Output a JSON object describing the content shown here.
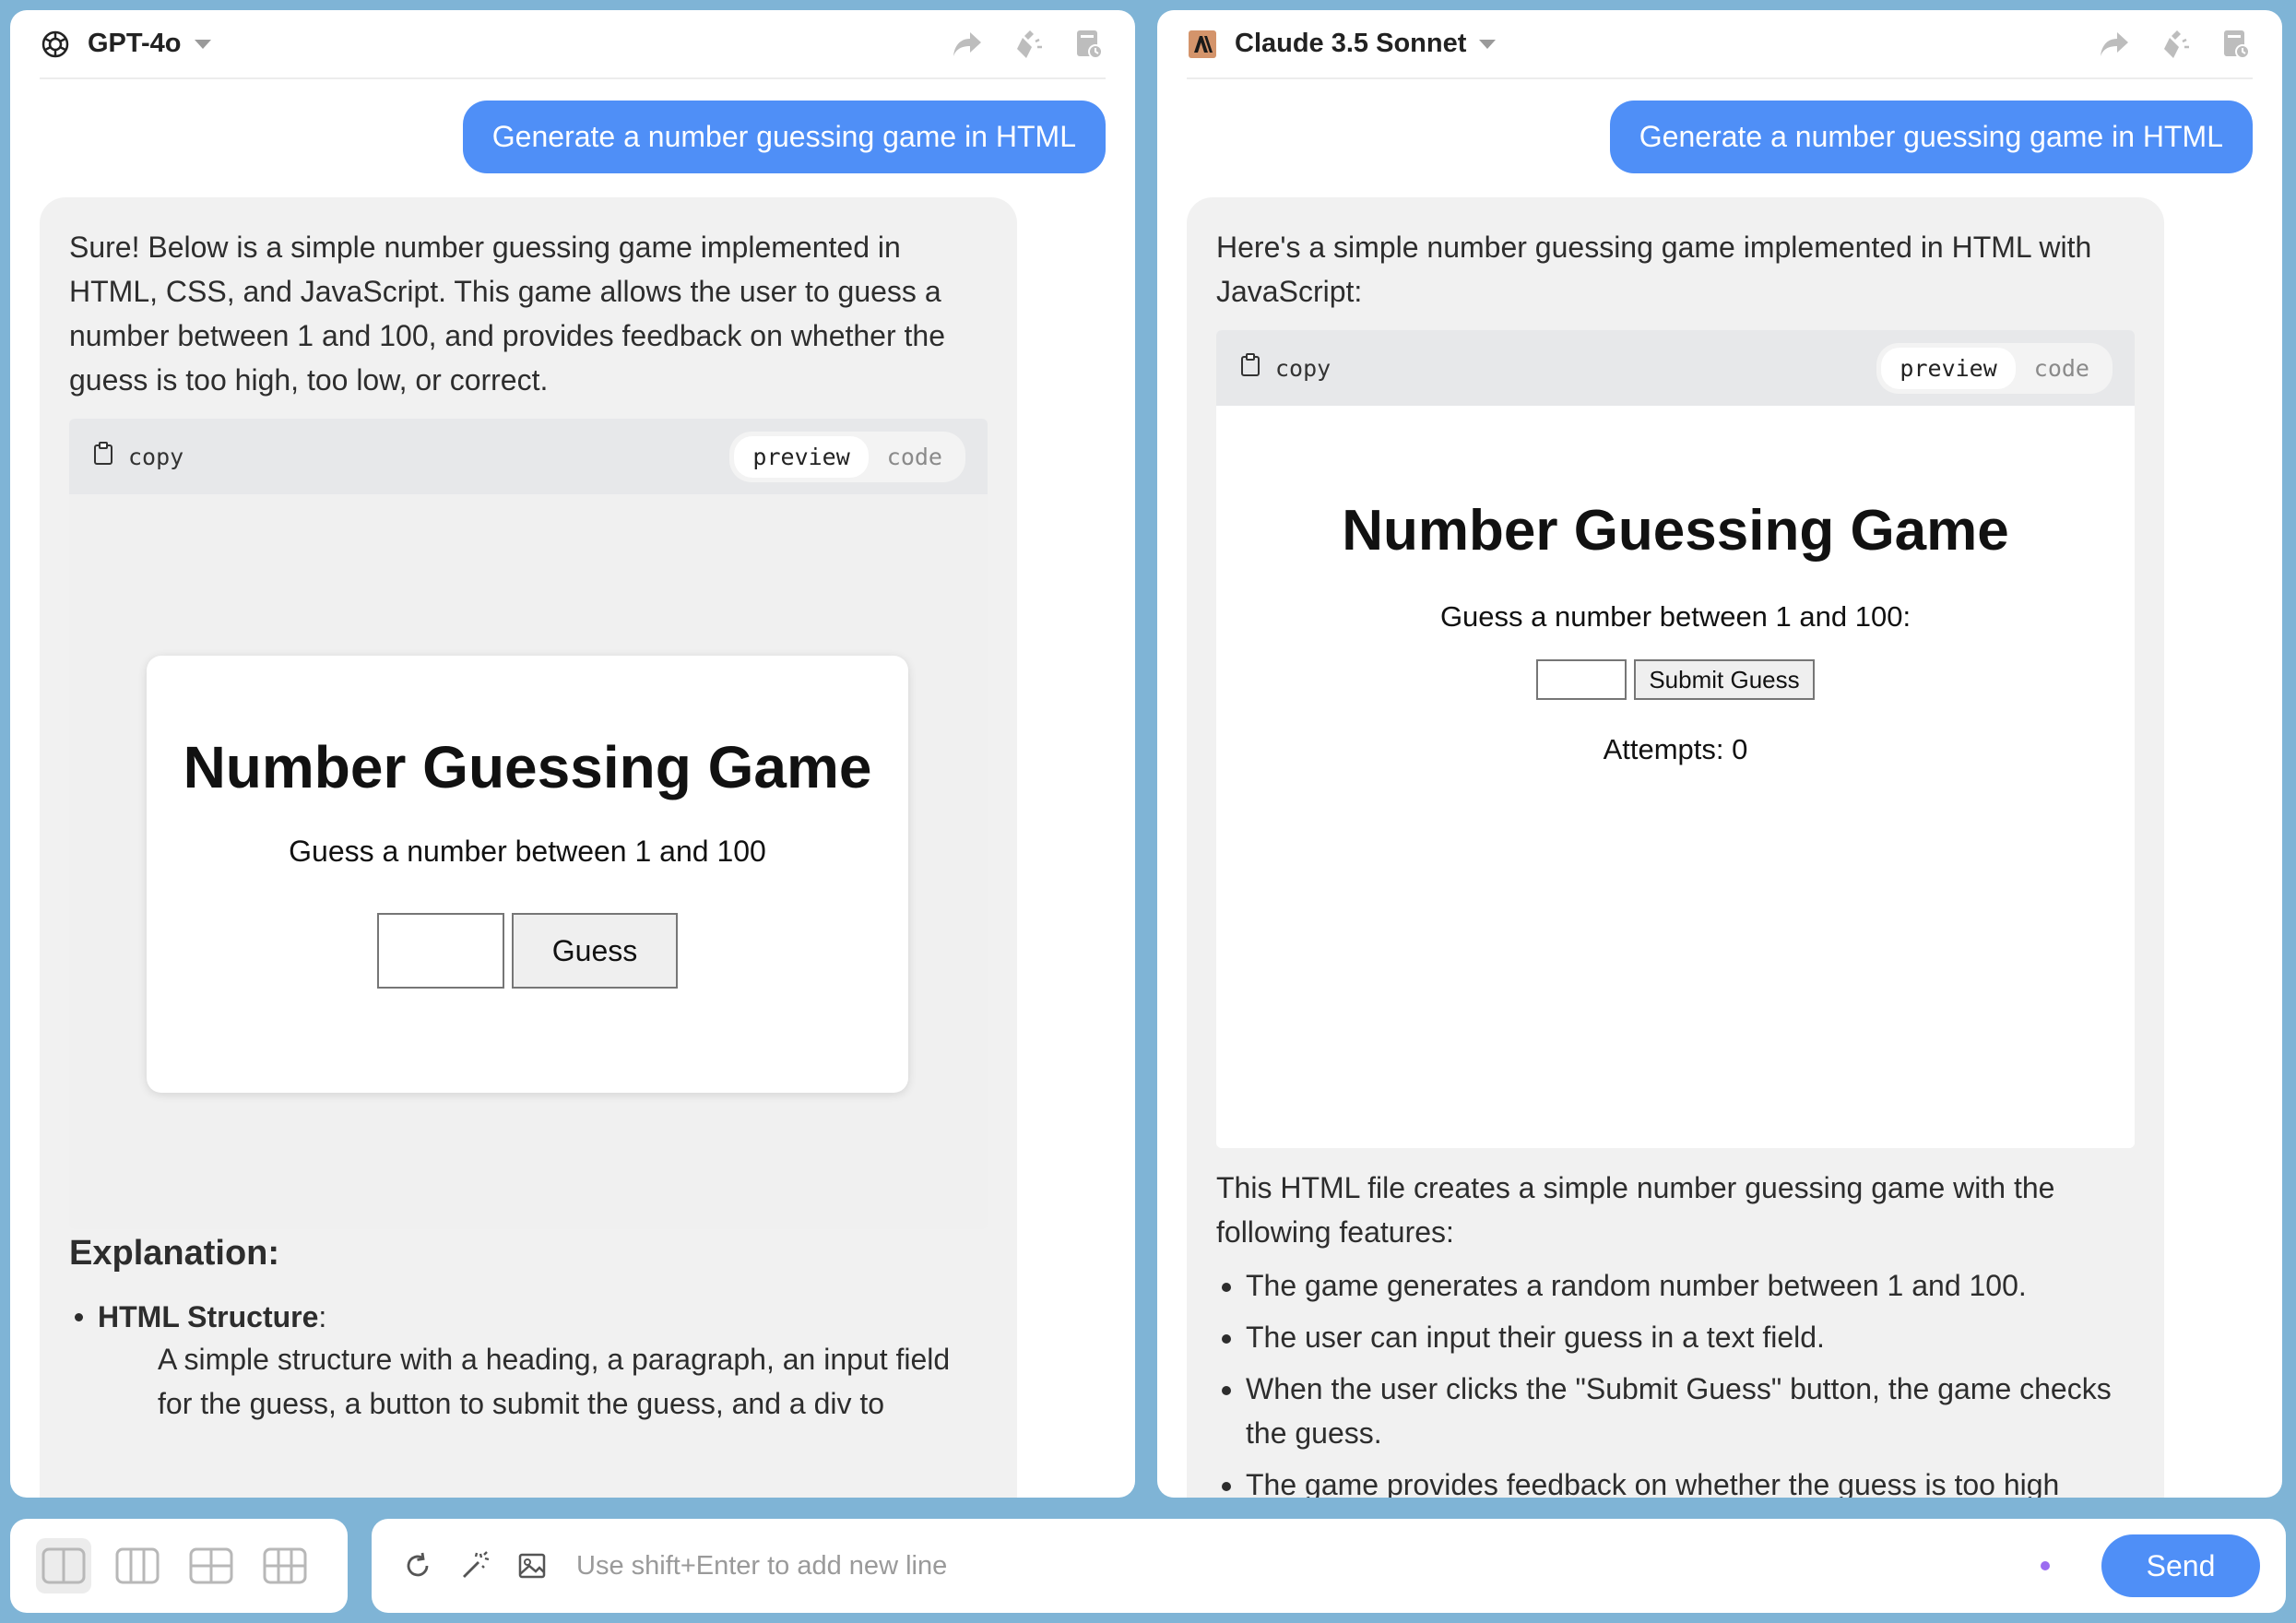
{
  "left_pane": {
    "model_name": "GPT-4o",
    "user_message": "Generate a number guessing game in HTML",
    "assistant_intro": "Sure! Below is a simple number guessing game implemented in HTML, CSS, and JavaScript. This game allows the user to guess a number between 1 and 100, and provides feedback on whether the guess is too high, too low, or correct.",
    "code_block": {
      "copy_label": "copy",
      "tab_preview": "preview",
      "tab_code": "code",
      "active_tab": "preview"
    },
    "game_preview": {
      "title": "Number Guessing Game",
      "subtitle": "Guess a number between 1 and 100",
      "button_label": "Guess"
    },
    "explanation_heading": "Explanation:",
    "explanation_bullet_title": "HTML Structure",
    "explanation_bullet_text": "A simple structure with a heading, a paragraph, an input field for the guess, a button to submit the guess, and a div to"
  },
  "right_pane": {
    "model_name": "Claude 3.5 Sonnet",
    "user_message": "Generate a number guessing game in HTML",
    "assistant_intro": "Here's a simple number guessing game implemented in HTML with JavaScript:",
    "code_block": {
      "copy_label": "copy",
      "tab_preview": "preview",
      "tab_code": "code",
      "active_tab": "preview"
    },
    "game_preview": {
      "title": "Number Guessing Game",
      "subtitle": "Guess a number between 1 and 100:",
      "button_label": "Submit Guess",
      "attempts": "Attempts: 0"
    },
    "summary_intro": "This HTML file creates a simple number guessing game with the following features:",
    "features": [
      "The game generates a random number between 1 and 100.",
      "The user can input their guess in a text field.",
      "When the user clicks the \"Submit Guess\" button, the game checks the guess.",
      "The game provides feedback on whether the guess is too high"
    ]
  },
  "composer": {
    "placeholder": "Use shift+Enter to add new line",
    "send_label": "Send"
  },
  "colors": {
    "accent": "#4f8ff7",
    "background": "#7fb4d6",
    "status_dot": "#9b6cf0"
  },
  "icons": {
    "header_actions": [
      "share-icon",
      "clean-icon",
      "history-icon"
    ],
    "layout": [
      "layout-1-icon",
      "layout-2-icon",
      "layout-3-icon",
      "layout-4-icon"
    ],
    "tools": [
      "refresh-icon",
      "magic-wand-icon",
      "image-icon"
    ]
  }
}
